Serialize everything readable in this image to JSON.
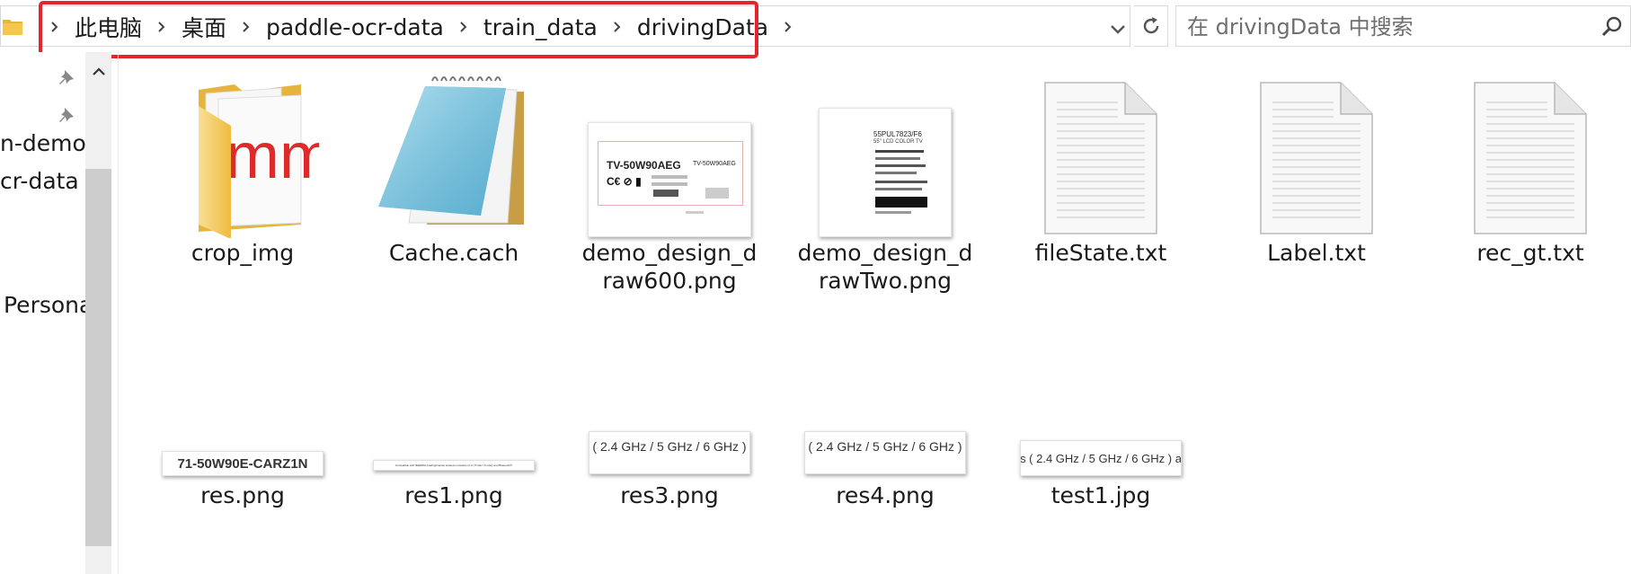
{
  "address_bar": {
    "crumbs": [
      "此电脑",
      "桌面",
      "paddle-ocr-data",
      "train_data",
      "drivingData"
    ]
  },
  "search": {
    "placeholder": "在 drivingData 中搜索"
  },
  "nav": {
    "items": [
      "n-demo",
      "cr-data",
      "Persona"
    ]
  },
  "files": [
    {
      "name": "crop_img",
      "type": "folder"
    },
    {
      "name": "Cache.cach",
      "type": "notepad"
    },
    {
      "name": "demo_design_draw600.png",
      "line1": "demo_design_d",
      "line2": "raw600.png",
      "type": "image",
      "preview": {
        "model": "TV-50W90AEG",
        "model2": "TV-50W90AEG"
      }
    },
    {
      "name": "demo_design_drawTwo.png",
      "line1": "demo_design_d",
      "line2": "rawTwo.png",
      "type": "image",
      "preview": {
        "model": "55PUL7823/F6",
        "sub": "55\" LCD COLOR TV"
      }
    },
    {
      "name": "fileState.txt",
      "type": "text"
    },
    {
      "name": "Label.txt",
      "type": "text"
    },
    {
      "name": "rec_gt.txt",
      "type": "text"
    },
    {
      "name": "res.png",
      "type": "strip",
      "strip_text": "71-50W90E-CARZ1N"
    },
    {
      "name": "res1.png",
      "type": "strip",
      "strip_text": "Compatible with IEEE802.11a/b/g/n/ac/ax wireless networks (2.4 / 5 GHz / 6 GHz) and Bluetooth®"
    },
    {
      "name": "res3.png",
      "type": "strip",
      "strip_text": "( 2.4 GHz / 5 GHz / 6 GHz )"
    },
    {
      "name": "res4.png",
      "type": "strip",
      "strip_text": "( 2.4 GHz / 5 GHz / 6 GHz )"
    },
    {
      "name": "test1.jpg",
      "type": "strip",
      "strip_text": "s ( 2.4 GHz / 5 GHz / 6 GHz ) a"
    }
  ],
  "colors": {
    "highlight": "#e2262b",
    "folder": "#f5c84c"
  }
}
